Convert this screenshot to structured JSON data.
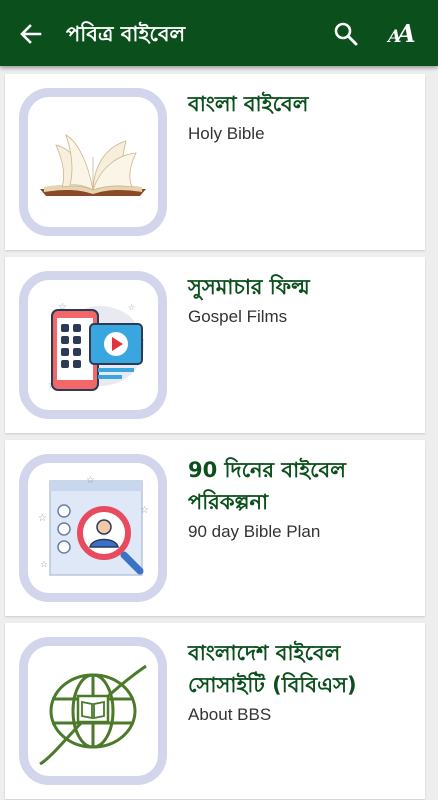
{
  "header": {
    "title": "পবিত্র বাইবেল",
    "back_icon": "arrow-left-icon",
    "search_icon": "search-icon",
    "font_icon": "font-size-icon",
    "font_icon_small": "A",
    "font_icon_large": "A"
  },
  "colors": {
    "app_bar": "#0b4f1d",
    "title_text": "#0b4f1d",
    "thumbnail_border": "#d3d5ec",
    "background": "#eeeeee"
  },
  "items": [
    {
      "title_bn": "বাংলা বাইবেল",
      "title_en": "Holy Bible",
      "icon": "open-book-icon"
    },
    {
      "title_bn": "সুসমাচার ফিল্ম",
      "title_en": "Gospel Films",
      "icon": "video-phone-icon"
    },
    {
      "title_bn": "90 দিনের বাইবেল পরিকল্পনা",
      "title_en": "90 day Bible Plan",
      "icon": "user-search-icon"
    },
    {
      "title_bn": "বাংলাদেশ বাইবেল সোসাইটি (বিবিএস)",
      "title_en": "About BBS",
      "icon": "globe-book-icon"
    }
  ]
}
